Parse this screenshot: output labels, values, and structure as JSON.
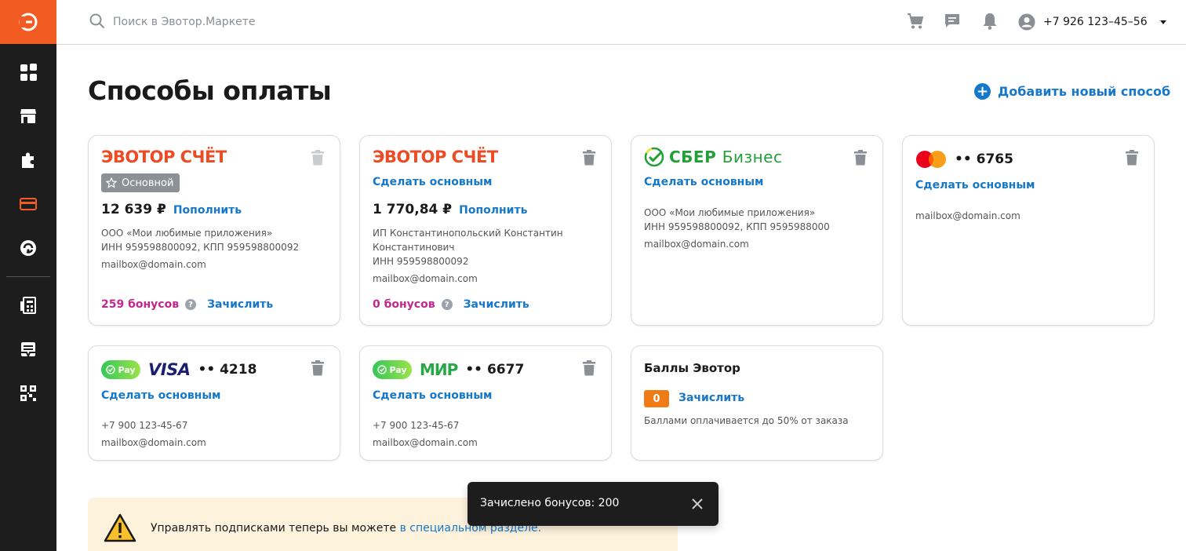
{
  "header": {
    "search_placeholder": "Поиск в Эвотор.Маркете",
    "user_phone": "+7 926 123–45–56"
  },
  "sidebar": {
    "items": [
      {
        "icon": "dashboard-icon",
        "active": false
      },
      {
        "icon": "store-icon",
        "active": false
      },
      {
        "icon": "puzzle-icon",
        "active": false
      },
      {
        "icon": "credit-card-icon",
        "active": true
      },
      {
        "icon": "subscription-icon",
        "active": false
      },
      {
        "icon": "cash-register-icon",
        "active": false
      },
      {
        "icon": "receipt-icon",
        "active": false
      },
      {
        "icon": "qr-code-icon",
        "active": false
      }
    ]
  },
  "page": {
    "title": "Способы оплаты",
    "add_label": "Добавить новый способ"
  },
  "cards": {
    "evotor1": {
      "brand": "ЭВОТОР СЧЁТ",
      "badge": "Основной",
      "amount": "12 639 ₽",
      "topup": "Пополнить",
      "org": "ООО «Мои любимые приложения»",
      "inn": "ИНН 959598800092, КПП 959598800092",
      "email": "mailbox@domain.com",
      "bonus": "259 бонусов",
      "credit": "Зачислить"
    },
    "evotor2": {
      "brand": "ЭВОТОР СЧЁТ",
      "make_main": "Сделать основным",
      "amount": "1 770,84 ₽",
      "topup": "Пополнить",
      "org_line1": "ИП Константинопольский Константин",
      "org_line2": "Константинович",
      "inn": "ИНН 959598800092",
      "email": "mailbox@domain.com",
      "bonus": "0 бонусов",
      "credit": "Зачислить"
    },
    "sber": {
      "brand_bold": "СБЕР",
      "brand_light": "Бизнес",
      "make_main": "Сделать основным",
      "org": "ООО «Мои любимые приложения»",
      "inn": "ИНН 959598800092, КПП 9595988000",
      "email": "mailbox@domain.com"
    },
    "mastercard": {
      "pan": "•• 6765",
      "make_main": "Сделать основным",
      "email": "mailbox@domain.com"
    },
    "visa": {
      "pay": "Pay",
      "brand": "VISA",
      "pan": "•• 4218",
      "make_main": "Сделать основным",
      "phone": "+7 900 123-45-67",
      "email": "mailbox@domain.com"
    },
    "mir": {
      "pay": "Pay",
      "brand": "МИР",
      "pan": "•• 6677",
      "make_main": "Сделать основным",
      "phone": "+7 900 123-45-67",
      "email": "mailbox@domain.com"
    },
    "points": {
      "title": "Баллы Эвотор",
      "value": "0",
      "credit": "Зачислить",
      "note": "Баллами оплачивается до 50% от заказа"
    }
  },
  "banner": {
    "text": "Управлять подписками теперь вы можете ",
    "link": "в специальном разделе."
  },
  "toast": {
    "text": "Зачислено бонусов: 200"
  },
  "colors": {
    "brand_orange": "#f25c22",
    "link_blue": "#1778c9",
    "bonus_magenta": "#c0278f",
    "sidebar_dark": "#1d1d1d"
  }
}
